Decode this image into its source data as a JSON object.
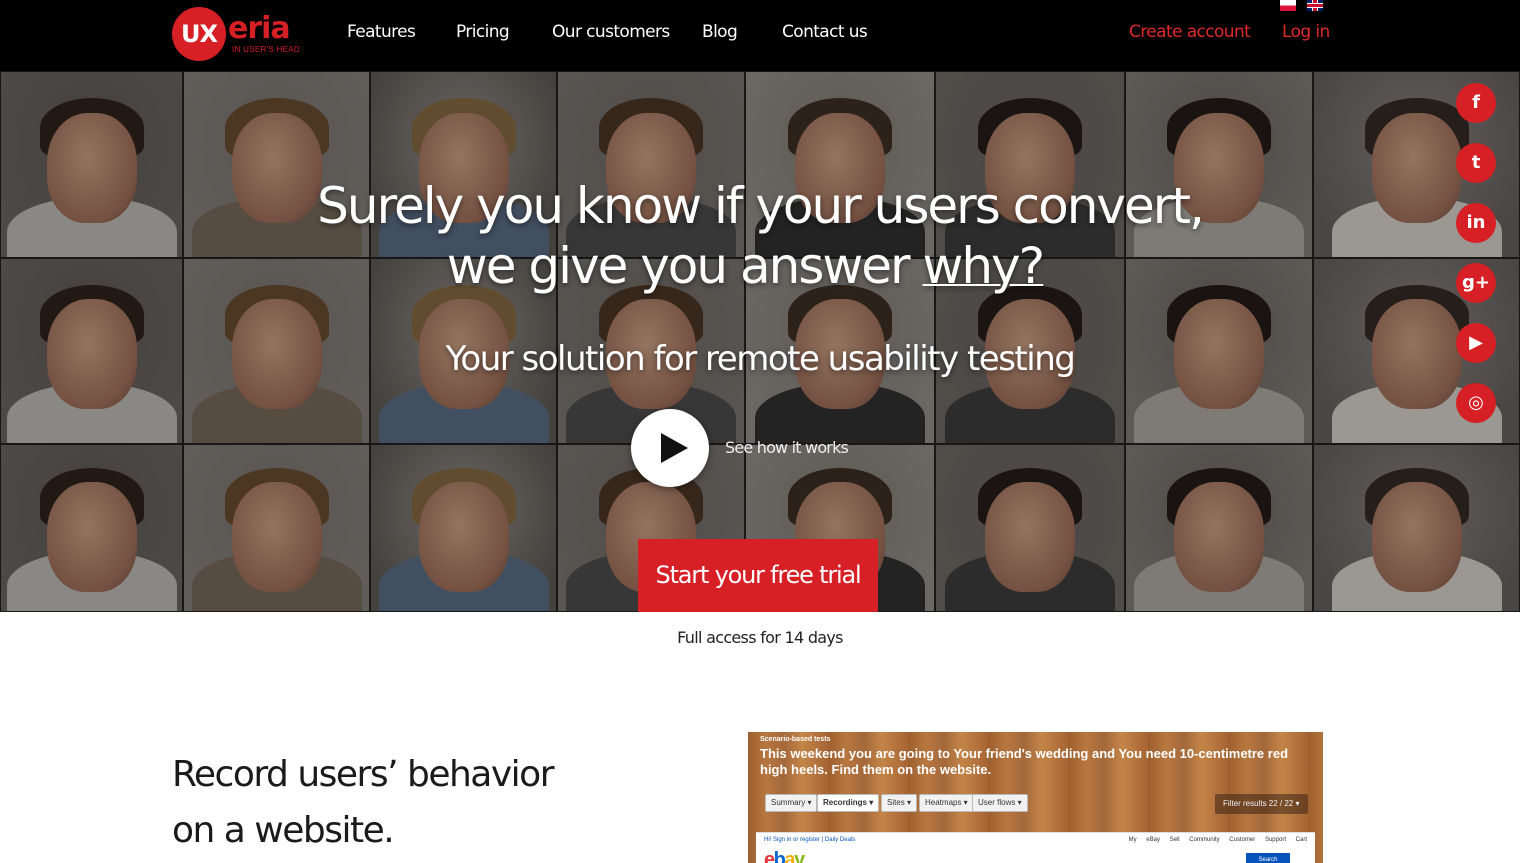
{
  "nav": {
    "logo_mark": "UX",
    "logo_word": "eria",
    "logo_tagline": "IN USER'S HEAD",
    "links": [
      "Features",
      "Pricing",
      "Our customers",
      "Blog",
      "Contact us"
    ],
    "create_account": "Create account",
    "login": "Log in"
  },
  "hero": {
    "headline_line1": "Surely you know if your users convert,",
    "headline_line2_prefix": "we give you answer ",
    "headline_line2_emph": "why?",
    "subtitle": "Your solution for remote usability testing",
    "video_label": "See how it works",
    "cta_label": "Start your free trial",
    "social_icons": [
      "facebook-icon",
      "twitter-icon",
      "linkedin-icon",
      "google-plus-icon",
      "youtube-icon",
      "instagram-icon"
    ],
    "social_glyphs": [
      "f",
      "t",
      "in",
      "g+",
      "▶",
      "◎"
    ]
  },
  "trial_note": "Full access for 14 days",
  "feature": {
    "title_line1": "Record users’ behavior",
    "title_line2": "on a website.",
    "screenshot": {
      "tag": "Scenario-based tests",
      "task": "This weekend you are going to Your friend's wedding and You need 10-centimetre red high heels. Find them on the website.",
      "tabs": [
        "Summary ▾",
        "Recordings ▾",
        "Sites ▾",
        "Heatmaps ▾",
        "User flows ▾"
      ],
      "active_tab": "Recordings ▾",
      "filter": "Filter results 22 / 22 ▾",
      "page_signin": "Hi! Sign in or register | Daily Deals",
      "page_links": "My eBay Sell Community Customer Support Cart",
      "search_label": "Search"
    }
  },
  "colors": {
    "brand_red": "#d71f26",
    "nav_bg": "#000000"
  }
}
